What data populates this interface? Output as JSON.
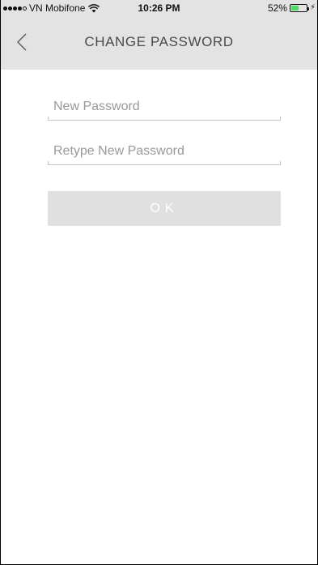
{
  "status_bar": {
    "carrier": "VN Mobifone",
    "time": "10:26 PM",
    "battery_percent": "52%",
    "battery_level": 0.52,
    "signal_bars_filled": 4,
    "signal_bars_total": 5
  },
  "nav": {
    "title": "CHANGE PASSWORD",
    "back_icon": "chevron-left-icon"
  },
  "form": {
    "new_password": {
      "placeholder": "New Password",
      "value": ""
    },
    "retype_password": {
      "placeholder": "Retype New Password",
      "value": ""
    },
    "ok_label": "OK"
  },
  "colors": {
    "header_bg": "#e3e3e3",
    "button_bg": "#e0e0e0",
    "battery_fill": "#4cd964"
  }
}
